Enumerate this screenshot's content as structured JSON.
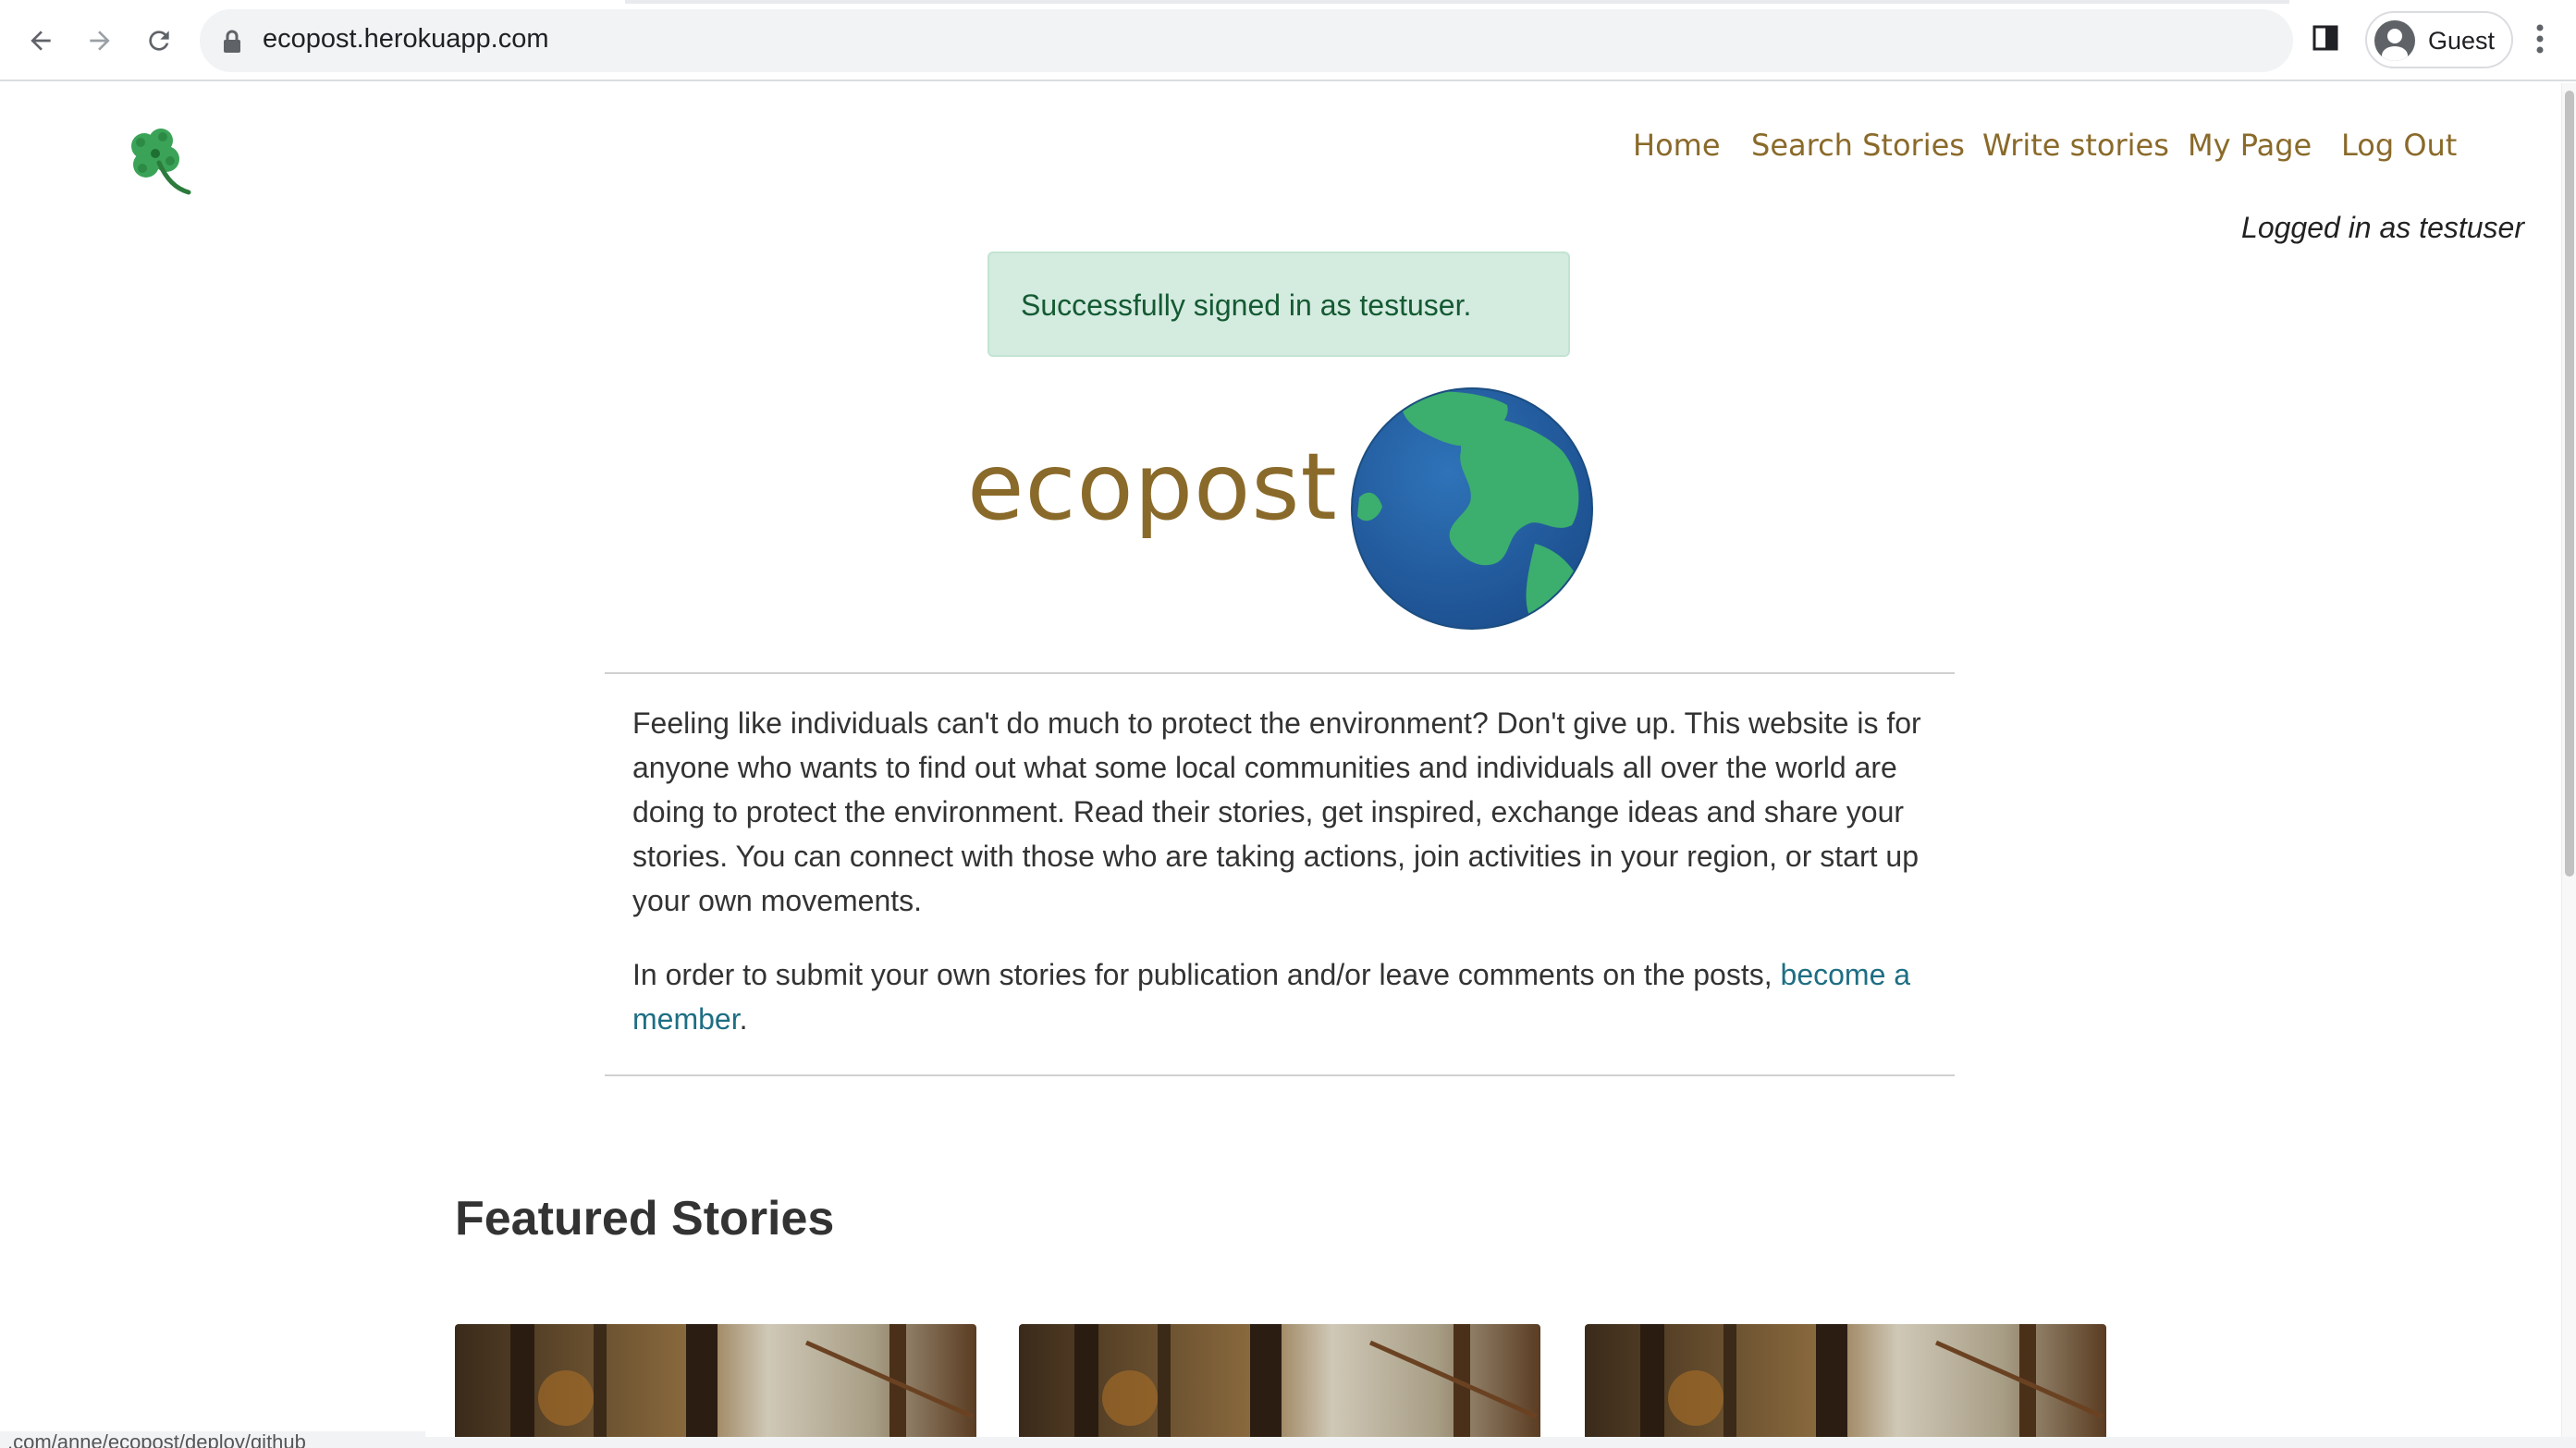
{
  "browser": {
    "url": "ecopost.herokuapp.com",
    "profile_label": "Guest",
    "status_url": ".com/anne/ecopost/deploy/github"
  },
  "nav": {
    "home": "Home",
    "search": "Search Stories",
    "write": "Write stories",
    "mypage": "My Page",
    "logout": "Log Out"
  },
  "logged_in_text": "Logged in as testuser",
  "flash_message": "Successfully signed in as testuser.",
  "brand_name": "ecopost",
  "intro": {
    "paragraph1": "Feeling like individuals can't do much to protect the environment? Don't give up. This website is for anyone who wants to find out what some local communities and individuals all over the world are doing to protect the environment. Read their stories, get inspired, exchange ideas and share your stories. You can connect with those who are taking actions, join activities in your region, or start up your own movements.",
    "paragraph2_prefix": "In order to submit your own stories for publication and/or leave comments on the posts, ",
    "paragraph2_link": "become a member",
    "paragraph2_suffix": "."
  },
  "featured_title": "Featured Stories",
  "colors": {
    "accent_brown": "#8a6a2a",
    "link_teal": "#1e6e83",
    "flash_bg": "#d4ebe0",
    "flash_text": "#145a32"
  },
  "icons": [
    "back-arrow-icon",
    "forward-arrow-icon",
    "reload-icon",
    "lock-icon",
    "side-panel-icon",
    "profile-icon",
    "menu-kebab-icon",
    "clover-icon",
    "globe-icon"
  ]
}
